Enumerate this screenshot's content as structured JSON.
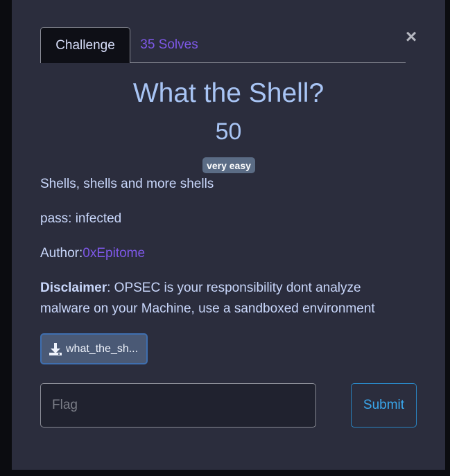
{
  "tabs": {
    "challenge": "Challenge",
    "solves": "35 Solves"
  },
  "close_symbol": "×",
  "challenge": {
    "title": "What the Shell?",
    "points": "50",
    "difficulty": "very easy",
    "description": "Shells, shells and more shells",
    "pass": "pass: infected",
    "author_label": "Author:",
    "author_name": "0xEpitome",
    "disclaimer_label": "Disclaimer",
    "disclaimer_text": ": OPSEC is your responsibility dont analyze malware on your Machine, use a sandboxed environment"
  },
  "file": {
    "name": "what_the_sh...",
    "icon": "download-icon"
  },
  "flag": {
    "placeholder": "Flag",
    "value": ""
  },
  "submit_label": "Submit",
  "colors": {
    "background": "#2b2d3d",
    "title": "#a8c4f4",
    "link": "#7e58e8",
    "submit": "#3aa8ee",
    "badge": "#5b6c85"
  }
}
